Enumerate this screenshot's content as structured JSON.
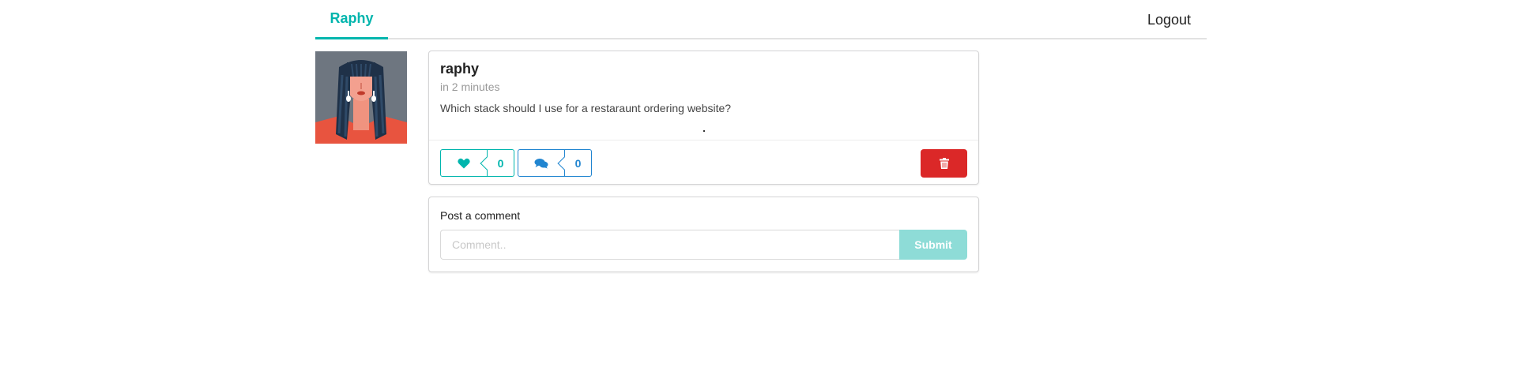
{
  "menu": {
    "active_tab": "Raphy",
    "logout_label": "Logout"
  },
  "post": {
    "author": "raphy",
    "time": "in 2 minutes",
    "description": "Which stack should I use for a restaraunt ordering website?",
    "likes": "0",
    "comments": "0",
    "icons": {
      "like": "heart-icon",
      "comment": "comments-icon",
      "delete": "trash-icon"
    }
  },
  "comment_form": {
    "label": "Post a comment",
    "placeholder": "Comment..",
    "submit_label": "Submit"
  },
  "colors": {
    "teal": "#00b5ad",
    "blue": "#2185d0",
    "red": "#db2828",
    "submit_disabled": "#8edcd7"
  }
}
